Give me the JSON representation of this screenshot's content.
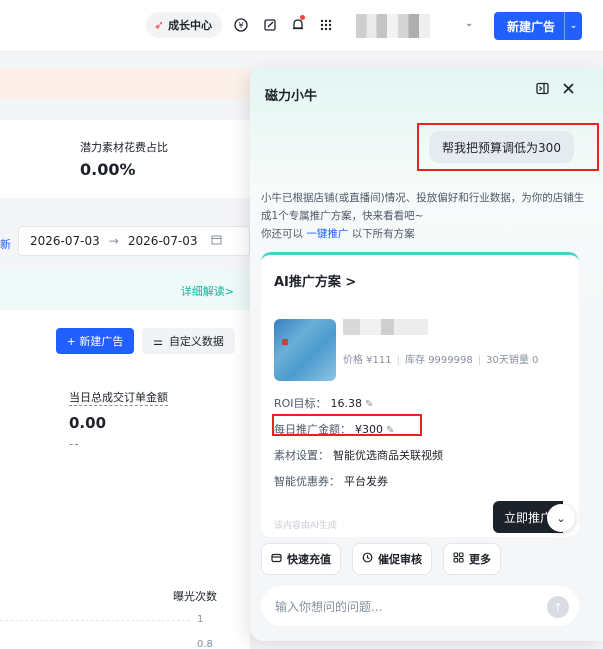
{
  "header": {
    "growth_center": "成长中心",
    "new_ad": "新建广告"
  },
  "background": {
    "stat_label": "潜力素材花费占比",
    "stat_value": "0.00%",
    "date_prefix": "新",
    "date_start": "2026-07-03",
    "date_end": "2026-07-03",
    "date_arrow": "→",
    "detail_link": "详细解读>",
    "btn_new_ad": "+ 新建广告",
    "btn_custom": "自定义数据",
    "gmv_label": "当日总成交订单金额",
    "gmv_value": "0.00",
    "gmv_dash": "--",
    "exposure_label": "曝光次数",
    "tick_1": "1",
    "tick_08": "0.8"
  },
  "chat": {
    "title": "磁力小牛",
    "user_message": "帮我把预算调低为300",
    "intro_text": "小牛已根据店铺(或直播间)情况、投放偏好和行业数据，为你的店铺生成1个专属推广方案，快来看看吧~",
    "intro_prefix": "你还可以",
    "intro_link": "一键推广",
    "intro_suffix": "以下所有方案",
    "plan": {
      "title": "AI推广方案 >",
      "product_meta": {
        "price": "价格 ¥111",
        "stock": "库存 9999998",
        "sales": "30天销量 0"
      },
      "roi_label": "ROI目标：",
      "roi_value": "16.38",
      "budget_label": "每日推广金额：",
      "budget_value": "¥300",
      "material_label": "素材设置：",
      "material_value": "智能优选商品关联视频",
      "coupon_label": "智能优惠券：",
      "coupon_value": "平台发券",
      "ai_note": "该内容由AI生成"
    },
    "launch_button": "立即推广",
    "chips": [
      "快速充值",
      "催促审核",
      "更多"
    ],
    "input_placeholder": "输入你想问的问题..."
  },
  "colors": {
    "accent_blue": "#2160ff",
    "highlight_red": "#e8231f",
    "teal": "#0fb4a0"
  }
}
